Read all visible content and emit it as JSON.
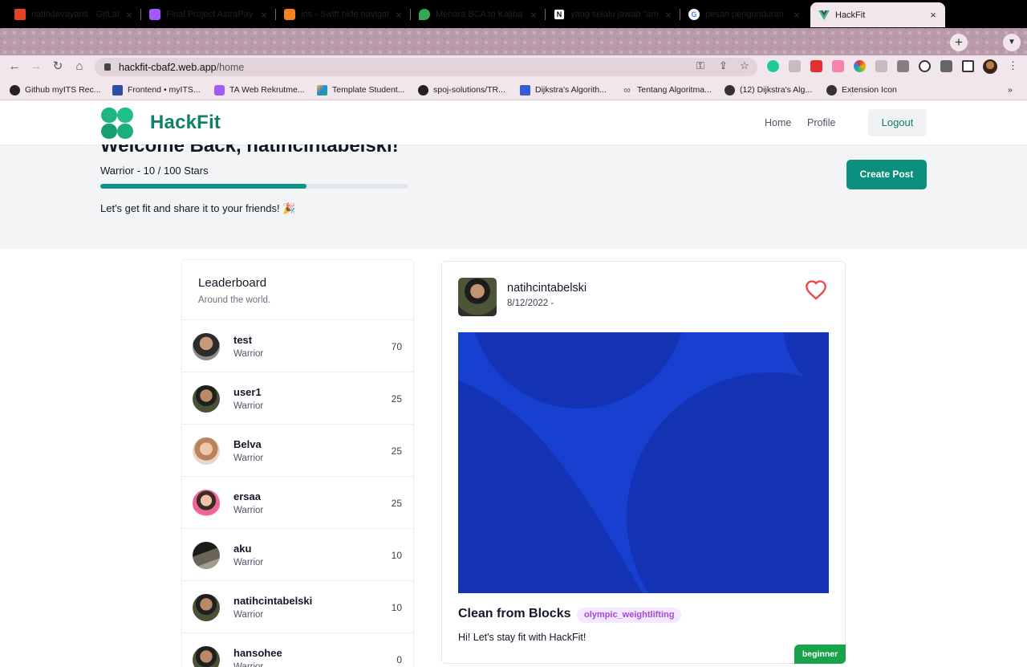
{
  "browser": {
    "tabs": [
      {
        "label": "natihdevayanti · GitLab",
        "icon": "gitlab-icon",
        "color": "#e24329"
      },
      {
        "label": "Final Project AstraPay – ",
        "icon": "figma-icon",
        "color": "#a259ff"
      },
      {
        "label": "ios - Swift hide navigati",
        "icon": "stackoverflow-icon",
        "color": "#f48024"
      },
      {
        "label": "Menara BCA to Kalibata",
        "icon": "maps-pin-icon",
        "color": "#34a853"
      },
      {
        "label": "yang selalu jawab \"ama",
        "icon": "notion-icon",
        "color": "#111111"
      },
      {
        "label": "pesan pengunduran dir",
        "icon": "google-icon",
        "color": "#4285f4"
      },
      {
        "label": "HackFit",
        "icon": "vue-icon",
        "color": "#41b883"
      }
    ],
    "new_tab": "+",
    "tab_close": "×",
    "url_host": "hackfit-cbaf2.web.app",
    "url_path": "/home",
    "bookmarks": [
      {
        "label": "Github myITS Rec...",
        "icon": "github-icon",
        "color": "#222222"
      },
      {
        "label": "Frontend • myITS...",
        "icon": "its-icon",
        "color": "#2b4fa8"
      },
      {
        "label": "TA Web Rekrutme...",
        "icon": "figma-icon",
        "color": "#a259ff"
      },
      {
        "label": "Template Student...",
        "icon": "drive-icon",
        "color": "#1e88e5"
      },
      {
        "label": "spoj-solutions/TR...",
        "icon": "github-icon",
        "color": "#222222"
      },
      {
        "label": "Dijkstra's Algorith...",
        "icon": "grid-icon",
        "color": "#3a5bd9"
      },
      {
        "label": "Tentang Algoritma...",
        "icon": "infinity-icon",
        "color": "#555555"
      },
      {
        "label": "(12) Dijkstra's Alg...",
        "icon": "globe-icon",
        "color": "#333333"
      },
      {
        "label": "Extension Icon",
        "icon": "globe-icon",
        "color": "#333333"
      }
    ],
    "bookmarks_more": "»"
  },
  "app": {
    "brand": "HackFit",
    "nav": {
      "home": "Home",
      "profile": "Profile",
      "logout": "Logout"
    },
    "accent": "#0d8f7f"
  },
  "hero": {
    "welcome": "Welcome Back, natihcintabelski!",
    "rank": "Warrior - 10 / 100 Stars",
    "progress_fraction": 0.67,
    "tagline": "Let's get fit and share it to your friends! 🎉",
    "create_post": "Create Post"
  },
  "leaderboard": {
    "title": "Leaderboard",
    "subtitle": "Around the world.",
    "rows": [
      {
        "name": "test",
        "role": "Warrior",
        "score": "70"
      },
      {
        "name": "user1",
        "role": "Warrior",
        "score": "25"
      },
      {
        "name": "Belva",
        "role": "Warrior",
        "score": "25"
      },
      {
        "name": "ersaa",
        "role": "Warrior",
        "score": "25"
      },
      {
        "name": "aku",
        "role": "Warrior",
        "score": "10"
      },
      {
        "name": "natihcintabelski",
        "role": "Warrior",
        "score": "10"
      },
      {
        "name": "hansohee",
        "role": "Warrior",
        "score": "0"
      }
    ]
  },
  "post": {
    "username": "natihcintabelski",
    "date": "8/12/2022 -",
    "title": "Clean from Blocks",
    "tag": "olympic_weightlifting",
    "body": "Hi! Let's stay fit with HackFit!",
    "level": "beginner"
  }
}
